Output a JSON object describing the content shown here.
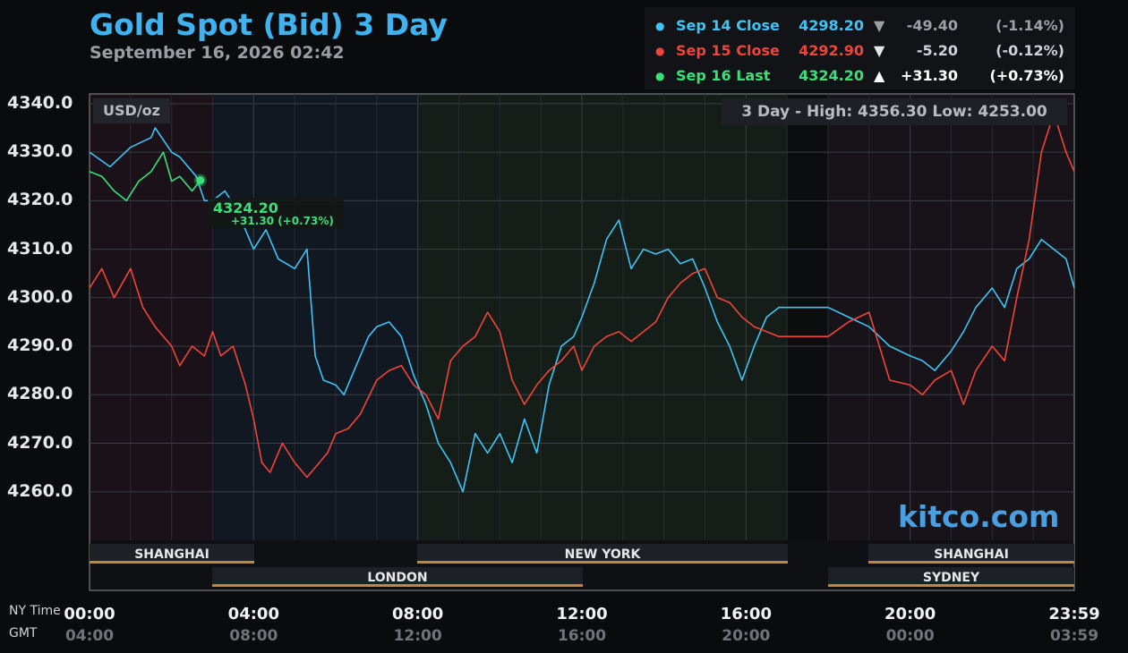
{
  "header": {
    "title": "Gold Spot (Bid) 3 Day",
    "subtitle": "September 16, 2026 02:42"
  },
  "legend": [
    {
      "name": "Sep 14 Close",
      "value": "4298.20",
      "arrow": "▼",
      "change": "-49.40",
      "pct": "(-1.14%)",
      "color": "#3ec4f5",
      "chg_color": "#9aa0a6"
    },
    {
      "name": "Sep 15 Close",
      "value": "4292.90",
      "arrow": "▼",
      "change": "-5.20",
      "pct": "(-0.12%)",
      "color": "#f0443a",
      "chg_color": "#cfd3d8"
    },
    {
      "name": "Sep 16 Last",
      "value": "4324.20",
      "arrow": "▲",
      "change": "+31.30",
      "pct": "(+0.73%)",
      "color": "#39e07a",
      "chg_color": "#ffffff"
    }
  ],
  "unit": "USD/oz",
  "high_low": "3 Day - High: 4356.30  Low: 4253.00",
  "watermark": "kitco.com",
  "last_marker": {
    "value": "4324.20",
    "change": "+31.30 (+0.73%)"
  },
  "sessions": {
    "shanghai_1": "SHANGHAI",
    "london": "LONDON",
    "new_york": "NEW YORK",
    "shanghai_2": "SHANGHAI",
    "sydney": "SYDNEY"
  },
  "tz": {
    "ny": "NY Time",
    "gmt": "GMT"
  },
  "chart_data": {
    "type": "line",
    "title": "Gold Spot (Bid) 3 Day",
    "ylabel": "USD/oz",
    "ylim": [
      4250,
      4342
    ],
    "yticks": [
      "4260.0",
      "4270.0",
      "4280.0",
      "4290.0",
      "4300.0",
      "4310.0",
      "4320.0",
      "4330.0",
      "4340.0"
    ],
    "xlim_hours": [
      0,
      24
    ],
    "x_ticks": [
      {
        "h": 0,
        "ny": "00:00",
        "gmt": "04:00"
      },
      {
        "h": 4,
        "ny": "04:00",
        "gmt": "08:00"
      },
      {
        "h": 8,
        "ny": "08:00",
        "gmt": "12:00"
      },
      {
        "h": 12,
        "ny": "12:00",
        "gmt": "16:00"
      },
      {
        "h": 16,
        "ny": "16:00",
        "gmt": "20:00"
      },
      {
        "h": 20,
        "ny": "20:00",
        "gmt": "00:00"
      },
      {
        "h": 24,
        "ny": "23:59",
        "gmt": "03:59"
      }
    ],
    "grid": true,
    "series": [
      {
        "name": "Sep 14 Close",
        "color": "#3ec4f5",
        "x": [
          0,
          0.5,
          1,
          1.5,
          1.6,
          2,
          2.2,
          2.6,
          2.8,
          3,
          3.3,
          3.6,
          4,
          4.3,
          4.6,
          5,
          5.3,
          5.5,
          5.7,
          6,
          6.2,
          6.5,
          6.8,
          7,
          7.3,
          7.6,
          7.9,
          8.2,
          8.5,
          8.8,
          9.1,
          9.4,
          9.7,
          10,
          10.3,
          10.6,
          10.9,
          11.2,
          11.5,
          11.8,
          12,
          12.3,
          12.6,
          12.9,
          13.2,
          13.5,
          13.8,
          14.1,
          14.4,
          14.7,
          15,
          15.3,
          15.6,
          15.9,
          16.2,
          16.5,
          16.8,
          17,
          17.5,
          18,
          18.5,
          19,
          19.5,
          20,
          20.3,
          20.6,
          21,
          21.3,
          21.6,
          22,
          22.3,
          22.6,
          22.9,
          23.2,
          23.5,
          23.8,
          24
        ],
        "y": [
          4330,
          4327,
          4331,
          4333,
          4335,
          4330,
          4329,
          4325,
          4320,
          4320,
          4322,
          4318,
          4310,
          4314,
          4308,
          4306,
          4310,
          4288,
          4283,
          4282,
          4280,
          4286,
          4292,
          4294,
          4295,
          4292,
          4284,
          4278,
          4270,
          4266,
          4260,
          4272,
          4268,
          4272,
          4266,
          4275,
          4268,
          4282,
          4290,
          4292,
          4296,
          4303,
          4312,
          4316,
          4306,
          4310,
          4309,
          4310,
          4307,
          4308,
          4302,
          4295,
          4290,
          4283,
          4290,
          4296,
          4298,
          4298,
          4298,
          4298,
          4296,
          4294,
          4290,
          4288,
          4287,
          4285,
          4289,
          4293,
          4298,
          4302,
          4298,
          4306,
          4308,
          4312,
          4310,
          4308,
          4302
        ]
      },
      {
        "name": "Sep 15 Close",
        "color": "#f0443a",
        "x": [
          0,
          0.3,
          0.6,
          1,
          1.3,
          1.6,
          2,
          2.2,
          2.5,
          2.8,
          3,
          3.2,
          3.5,
          3.8,
          4,
          4.2,
          4.4,
          4.7,
          5,
          5.3,
          5.5,
          5.8,
          6,
          6.3,
          6.6,
          7,
          7.3,
          7.6,
          7.9,
          8.2,
          8.5,
          8.8,
          9.1,
          9.4,
          9.7,
          10,
          10.3,
          10.6,
          10.9,
          11.2,
          11.5,
          11.8,
          12,
          12.3,
          12.6,
          12.9,
          13.2,
          13.5,
          13.8,
          14.1,
          14.4,
          14.7,
          15,
          15.3,
          15.6,
          15.9,
          16.2,
          16.5,
          16.8,
          17,
          17.5,
          18,
          18.5,
          19,
          19.5,
          20,
          20.3,
          20.6,
          21,
          21.3,
          21.6,
          22,
          22.3,
          22.6,
          22.9,
          23.2,
          23.5,
          23.8,
          24
        ],
        "y": [
          4302,
          4306,
          4300,
          4306,
          4298,
          4294,
          4290,
          4286,
          4290,
          4288,
          4293,
          4288,
          4290,
          4282,
          4275,
          4266,
          4264,
          4270,
          4266,
          4263,
          4265,
          4268,
          4272,
          4273,
          4276,
          4283,
          4285,
          4286,
          4282,
          4280,
          4275,
          4287,
          4290,
          4292,
          4297,
          4293,
          4283,
          4278,
          4282,
          4285,
          4287,
          4290,
          4285,
          4290,
          4292,
          4293,
          4291,
          4293,
          4295,
          4300,
          4303,
          4305,
          4306,
          4300,
          4299,
          4296,
          4294,
          4293,
          4292,
          4292,
          4292,
          4292,
          4295,
          4297,
          4283,
          4282,
          4280,
          4283,
          4285,
          4278,
          4285,
          4290,
          4287,
          4300,
          4312,
          4330,
          4338,
          4330,
          4326
        ]
      },
      {
        "name": "Sep 16 Last",
        "color": "#39e07a",
        "x": [
          0,
          0.3,
          0.6,
          0.9,
          1.2,
          1.5,
          1.8,
          2,
          2.2,
          2.5,
          2.7
        ],
        "y": [
          4326,
          4325,
          4322,
          4320,
          4324,
          4326,
          4330,
          4324,
          4325,
          4322,
          4324.2
        ]
      }
    ]
  }
}
